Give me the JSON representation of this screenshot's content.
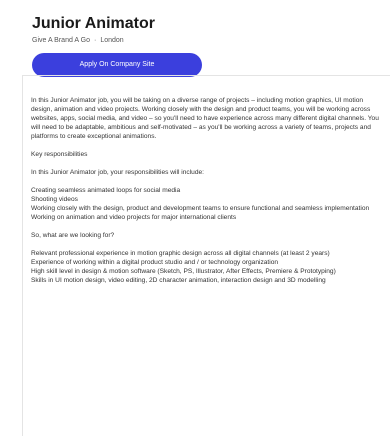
{
  "job": {
    "title": "Junior Animator",
    "company": "Give A Brand A Go",
    "location": "London",
    "apply_label": "Apply On Company Site"
  },
  "description": {
    "intro": "In this Junior Animator job, you will be taking on a diverse range of projects – including motion graphics, UI motion design, animation and video projects. Working closely with the design and product teams, you will be working across websites, apps, social media, and video – so you'll need to have experience across many different digital channels. You will need to be adaptable, ambitious and self-motivated – as you'll be working across a variety of teams, projects and platforms to create exceptional animations.",
    "key_heading": "Key responsibilities",
    "resp_intro": "In this Junior Animator job, your responsibilities will include:",
    "responsibilities": [
      "Creating seamless animated loops for social media",
      "Shooting videos",
      "Working closely with the design, product and development teams to ensure functional and seamless implementation",
      "Working on animation and video projects for major international clients"
    ],
    "looking_heading": "So, what are we looking for?",
    "requirements": [
      "Relevant professional experience in motion graphic design across all digital channels (at least 2 years)",
      "Experience of working within a digital product studio and / or technology organization",
      "High skill level in design & motion software (Sketch, PS, Illustrator, After Effects, Premiere & Prototyping)",
      "Skills in UI motion design, video editing, 2D character animation, interaction design and 3D modelling"
    ]
  }
}
